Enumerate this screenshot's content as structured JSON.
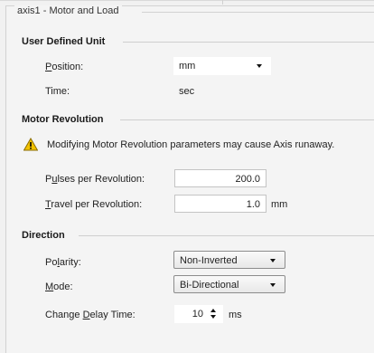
{
  "panel": {
    "title": "axis1 - Motor and Load"
  },
  "user_defined_unit": {
    "title": "User Defined Unit",
    "position_label": "Position:",
    "position_value": "mm",
    "time_label": "Time:",
    "time_value": "sec"
  },
  "motor_revolution": {
    "title": "Motor Revolution",
    "warning": "Modifying Motor Revolution parameters may cause Axis runaway.",
    "pulses_label": "Pulses per Revolution:",
    "pulses_value": "200.0",
    "travel_label": "Travel per Revolution:",
    "travel_value": "1.0",
    "travel_unit": "mm"
  },
  "direction": {
    "title": "Direction",
    "polarity_label": "Polarity:",
    "polarity_value": "Non-Inverted",
    "mode_label": "Mode:",
    "mode_value": "Bi-Directional",
    "delay_label": "Change Delay Time:",
    "delay_value": "10",
    "delay_unit": "ms"
  },
  "icons": {
    "warning": "warning-triangle-icon"
  },
  "colors": {
    "warning_fill": "#f2c200",
    "background": "#f1f1f1"
  }
}
